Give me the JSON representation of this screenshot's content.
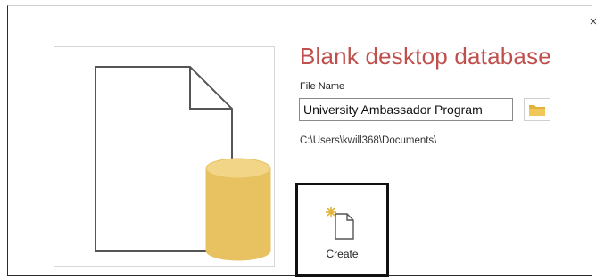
{
  "dialog": {
    "title": "Blank desktop database",
    "close_label": "×"
  },
  "file": {
    "label": "File Name",
    "name_value": "University Ambassador Program",
    "path": "C:\\Users\\kwill368\\Documents\\"
  },
  "icons": {
    "browse": "folder-icon",
    "create": "new-document-icon",
    "preview": "database-document-icon"
  },
  "create": {
    "label": "Create"
  },
  "colors": {
    "title": "#c0504d",
    "database_fill": "#e8c160",
    "folder": "#e2b33b"
  }
}
